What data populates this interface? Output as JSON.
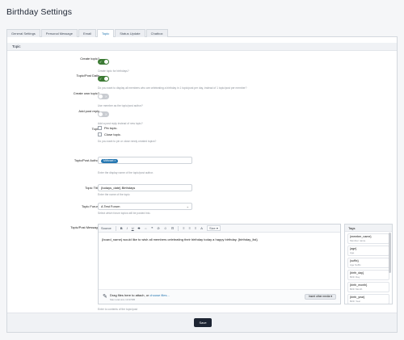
{
  "page": {
    "title": "Birthday Settings"
  },
  "tabs": [
    {
      "label": "General Settings",
      "active": false
    },
    {
      "label": "Personal Message",
      "active": false
    },
    {
      "label": "Email",
      "active": false
    },
    {
      "label": "Topic",
      "active": true
    },
    {
      "label": "Status Update",
      "active": false
    },
    {
      "label": "Chatbox",
      "active": false
    }
  ],
  "section": {
    "title": "Topic"
  },
  "create_topic": {
    "label": "Create topic?",
    "state": "on",
    "hint": "Create topic for birthdays?"
  },
  "topic_post_daily": {
    "label": "Topic/Post Daily",
    "state": "on",
    "hint": "Do you want to display all members who are celebrating a birthday in 1 topic/post per day, instead of 1 topic/post per member?"
  },
  "create_own_topic": {
    "label": "Create own topic?",
    "state": "off",
    "hint": "Use member as the topic/post author?"
  },
  "add_post_reply": {
    "label": "Add post reply",
    "state": "off",
    "hint": "Add a post reply instead of new topic?"
  },
  "topic_options": {
    "label": "Topic",
    "options": [
      {
        "label": "Pin topic."
      },
      {
        "label": "Close topic."
      }
    ],
    "hint": "Do you want to pin or close newly created topics?"
  },
  "author": {
    "label": "Topic/Post Author",
    "token": "Mithrael ×",
    "hint": "Enter the display name of the topic/post author."
  },
  "topic_title": {
    "label": "Topic Title",
    "value": "{todays_date} Birthdays",
    "hint": "Enter the name of the topic"
  },
  "topic_forum": {
    "label": "Topic Forum",
    "value": "A Test Forum",
    "hint": "Select which forum topics will be posted into."
  },
  "message": {
    "label": "Topic/Post Message",
    "toolbar": [
      "Source",
      "B",
      "I",
      "U",
      "S",
      "⇔",
      "❝",
      "⊘",
      "☺",
      "⊟",
      "≡",
      "≡",
      "≡",
      "A",
      "Size ▾"
    ],
    "body": "{board_name} would like to wish all members celebrating their birthday today a happy birthday. {birthday_list}",
    "attach_text": "Drag files here to attach, or ",
    "attach_link": "choose files...",
    "attach_sub": "Max total size 10.97MB",
    "insert_label": "Insert other media ▾",
    "hint": "Enter to contents of the topic/post"
  },
  "tags": {
    "title": "Tags",
    "items": [
      {
        "name": "{member_name}",
        "desc": "Member name"
      },
      {
        "name": "{age}",
        "desc": "Age"
      },
      {
        "name": "{suffix}",
        "desc": "Age Suffix"
      },
      {
        "name": "{birth_day}",
        "desc": "Birth Day"
      },
      {
        "name": "{birth_month}",
        "desc": "Birth Month"
      },
      {
        "name": "{birth_year}",
        "desc": "Birth Year"
      }
    ]
  },
  "footer": {
    "save_label": "Save"
  }
}
